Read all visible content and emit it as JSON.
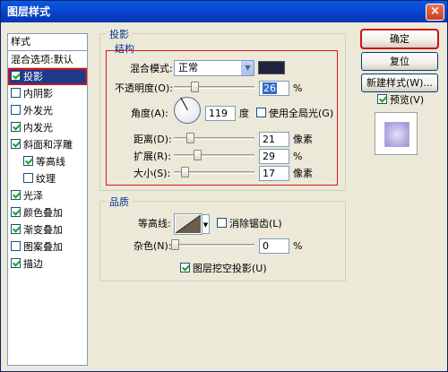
{
  "window": {
    "title": "图层样式",
    "close": "×"
  },
  "styles": {
    "header": "样式",
    "items": [
      {
        "label": "混合选项:默认",
        "checkbox": false,
        "checked": false,
        "sub": false
      },
      {
        "label": "投影",
        "checkbox": true,
        "checked": true,
        "sub": false,
        "selected": true
      },
      {
        "label": "内阴影",
        "checkbox": true,
        "checked": false,
        "sub": false
      },
      {
        "label": "外发光",
        "checkbox": true,
        "checked": false,
        "sub": false
      },
      {
        "label": "内发光",
        "checkbox": true,
        "checked": true,
        "sub": false
      },
      {
        "label": "斜面和浮雕",
        "checkbox": true,
        "checked": true,
        "sub": false
      },
      {
        "label": "等高线",
        "checkbox": true,
        "checked": true,
        "sub": true
      },
      {
        "label": "纹理",
        "checkbox": true,
        "checked": false,
        "sub": true
      },
      {
        "label": "光泽",
        "checkbox": true,
        "checked": true,
        "sub": false
      },
      {
        "label": "颜色叠加",
        "checkbox": true,
        "checked": true,
        "sub": false
      },
      {
        "label": "渐变叠加",
        "checkbox": true,
        "checked": true,
        "sub": false
      },
      {
        "label": "图案叠加",
        "checkbox": true,
        "checked": false,
        "sub": false
      },
      {
        "label": "描边",
        "checkbox": true,
        "checked": true,
        "sub": false
      }
    ]
  },
  "shadow": {
    "section_title": "投影",
    "structure_title": "结构",
    "blend_mode_label": "混合模式:",
    "blend_mode_value": "正常",
    "shadow_color": "#1E2340",
    "opacity_label": "不透明度(O):",
    "opacity_value": "26",
    "opacity_unit": "%",
    "opacity_level": 0.26,
    "angle_label": "角度(A):",
    "angle_value": "119",
    "angle_unit": "度",
    "global_light_label": "使用全局光(G)",
    "global_light_checked": false,
    "distance_label": "距离(D):",
    "distance_value": "21",
    "distance_unit": "像素",
    "spread_label": "扩展(R):",
    "spread_value": "29",
    "spread_unit": "%",
    "size_label": "大小(S):",
    "size_value": "17",
    "size_unit": "像素"
  },
  "quality": {
    "title": "品质",
    "contour_label": "等高线:",
    "antialias_label": "消除锯齿(L)",
    "antialias_checked": false,
    "noise_label": "杂色(N):",
    "noise_value": "0",
    "noise_unit": "%",
    "knockout_label": "图层挖空投影(U)",
    "knockout_checked": true
  },
  "buttons": {
    "ok": "确定",
    "reset": "复位",
    "new_style": "新建样式(W)...",
    "preview_label": "预览(V)",
    "preview_checked": true
  }
}
